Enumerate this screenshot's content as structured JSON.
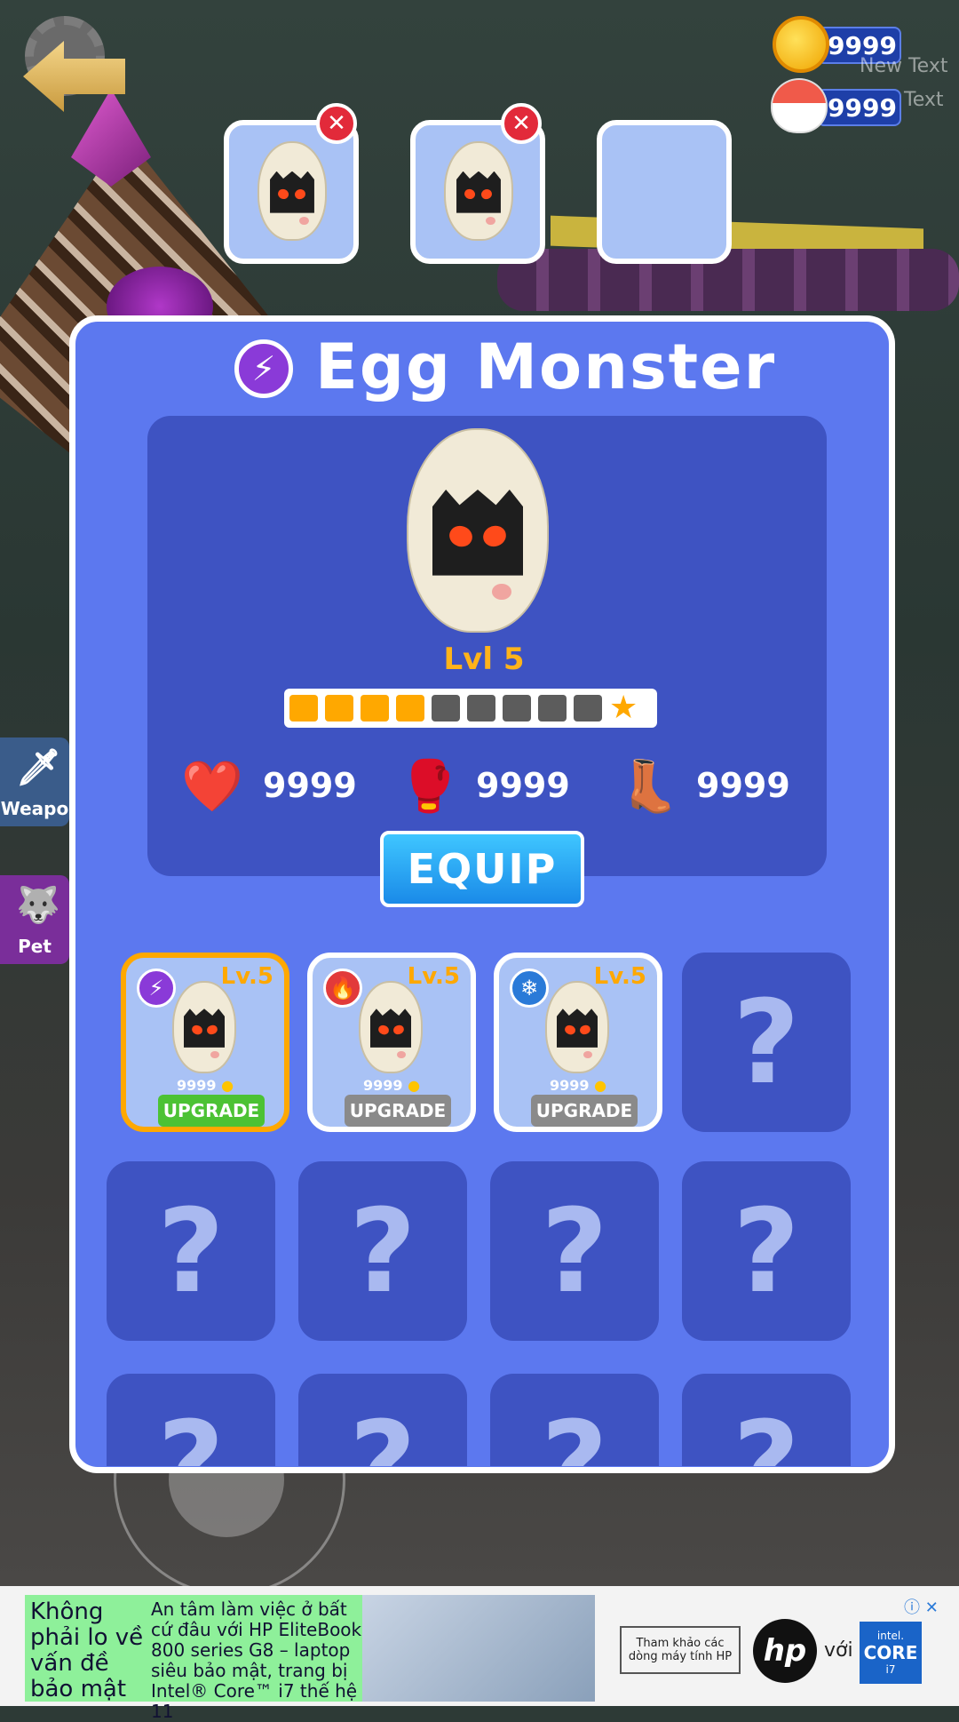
{
  "currency": {
    "coins": "9999",
    "eggs": "9999",
    "coins_hint": "New Text",
    "eggs_hint": "Text"
  },
  "panel": {
    "title": "Egg Monster",
    "level_label": "Lvl 5",
    "level_progress": {
      "filled": 4,
      "total": 9
    },
    "stats": {
      "health": "9999",
      "attack": "9999",
      "speed": "9999"
    },
    "equip_label": "EQUIP"
  },
  "pets": [
    {
      "level": "Lv.5",
      "cost": "9999",
      "upgrade_label": "UPGRADE",
      "element": "lightning-icon",
      "element_color": "#8a3ad8",
      "upgrade_color": "#4cc234"
    },
    {
      "level": "Lv.5",
      "cost": "9999",
      "upgrade_label": "UPGRADE",
      "element": "fire-icon",
      "element_color": "#e23a3a",
      "upgrade_color": "#8a8a8a"
    },
    {
      "level": "Lv.5",
      "cost": "9999",
      "upgrade_label": "UPGRADE",
      "element": "snowflake-icon",
      "element_color": "#2a7ad8",
      "upgrade_color": "#8a8a8a"
    }
  ],
  "locked_symbol": "?",
  "side_tabs": {
    "weapon": "Weapo",
    "pet": "Pet"
  },
  "ad": {
    "headline": "Không phải lo về vấn đề bảo mật",
    "body": "An tâm làm việc ở bất cứ đâu với HP EliteBook 800 series G8 – laptop siêu bảo mật, trang bị Intel® Core™ i7 thế hệ 11",
    "cta": "Tham khảo các dòng máy tính HP",
    "brand": "hp",
    "with": "với",
    "intel_line1": "intel.",
    "intel_line2": "CORE",
    "intel_line3": "i7"
  },
  "colors": {
    "panel": "#5c78ef",
    "panel_inner": "#3e53c2",
    "accent_orange": "#ffa800",
    "equip_blue": "#1a8ae8"
  }
}
